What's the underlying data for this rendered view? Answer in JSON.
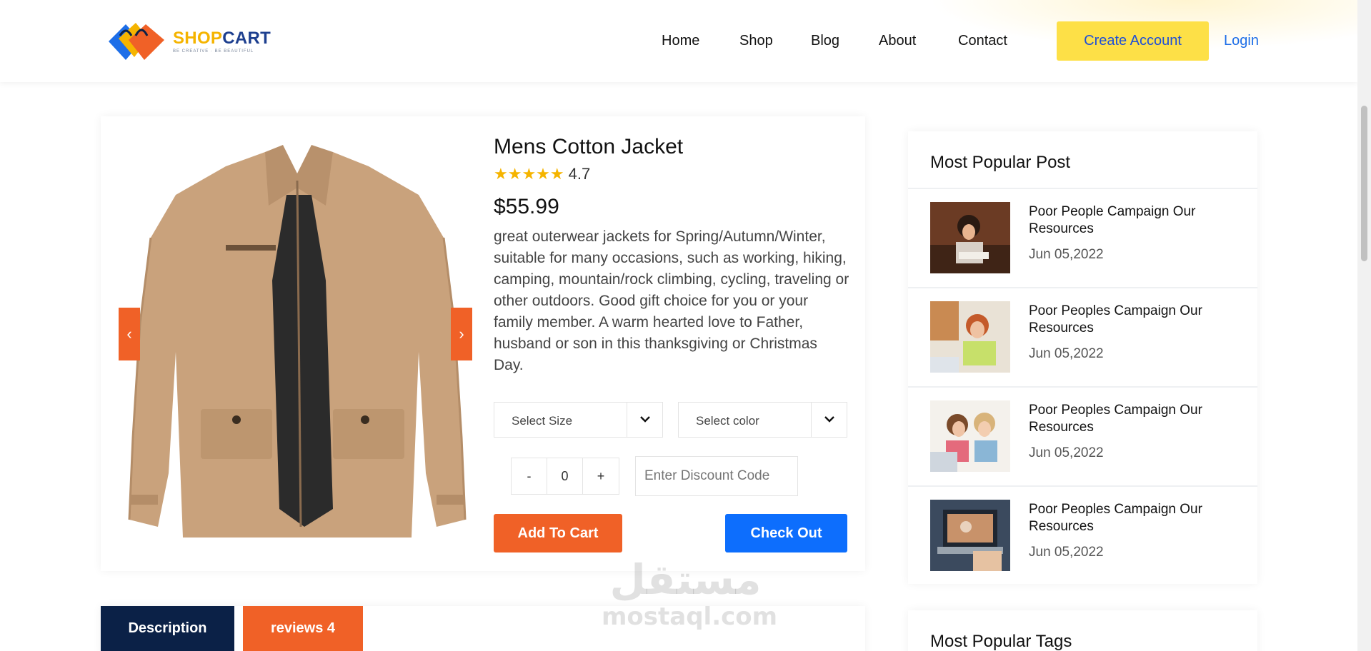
{
  "brand": {
    "name_part1": "SHOP",
    "name_part2": "CART",
    "tagline": "BE CREATIVE · BE BEAUTIFUL"
  },
  "nav": {
    "items": [
      "Home",
      "Shop",
      "Blog",
      "About",
      "Contact"
    ],
    "create_account": "Create Account",
    "login": "Login"
  },
  "product": {
    "title": "Mens Cotton Jacket",
    "stars": "★★★★★",
    "rating": "4.7",
    "price": "$55.99",
    "description": "great outerwear jackets for Spring/Autumn/Winter, suitable for many occasions, such as working, hiking, camping, mountain/rock climbing, cycling, traveling or other outdoors. Good gift choice for you or your family member. A warm hearted love to Father, husband or son in this thanksgiving or Christmas Day.",
    "size_select": "Select Size",
    "color_select": "Select color",
    "qty_minus": "-",
    "qty_value": "0",
    "qty_plus": "+",
    "discount_placeholder": "Enter Discount Code",
    "add_to_cart": "Add To Cart",
    "check_out": "Check Out",
    "prev_arrow": "‹",
    "next_arrow": "›"
  },
  "tabs": {
    "description": "Description",
    "reviews": "reviews 4"
  },
  "sidebar": {
    "popular_title": "Most Popular Post",
    "posts": [
      {
        "title": "Poor People Campaign Our Resources",
        "date": "Jun 05,2022"
      },
      {
        "title": "Poor Peoples Campaign Our Resources",
        "date": "Jun 05,2022"
      },
      {
        "title": "Poor Peoples Campaign Our Resources",
        "date": "Jun 05,2022"
      },
      {
        "title": "Poor Peoples Campaign Our Resources",
        "date": "Jun 05,2022"
      }
    ],
    "tags_title": "Most Popular Tags"
  },
  "watermark": {
    "arabic": "مستقل",
    "latin": "mostaql.com"
  },
  "colors": {
    "orange": "#f06127",
    "blue": "#0d6efd",
    "navy": "#0b2147",
    "yellow": "#fde047"
  }
}
